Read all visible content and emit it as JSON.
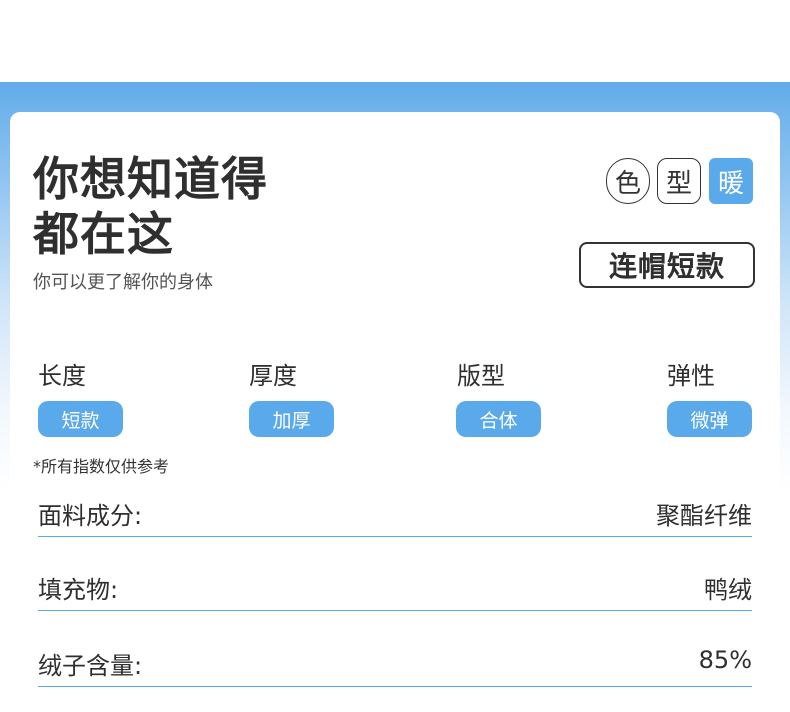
{
  "headline": {
    "line1": "你想知道得",
    "line2": "都在这",
    "subtitle": "你可以更了解你的身体"
  },
  "tags": [
    {
      "label": "色",
      "style": "circle",
      "active": false
    },
    {
      "label": "型",
      "style": "square",
      "active": false
    },
    {
      "label": "暖",
      "style": "square",
      "active": true
    }
  ],
  "model": "连帽短款",
  "attributes": [
    {
      "label": "长度",
      "value": "短款"
    },
    {
      "label": "厚度",
      "value": "加厚"
    },
    {
      "label": "版型",
      "value": "合体"
    },
    {
      "label": "弹性",
      "value": "微弹"
    }
  ],
  "note": "*所有指数仅供参考",
  "specs": [
    {
      "key": "面料成分:",
      "value": "聚酯纤维"
    },
    {
      "key": "填充物:",
      "value": "鸭绒"
    },
    {
      "key": "绒子含量:",
      "value": "85%"
    }
  ],
  "colors": {
    "accent": "#5aa9ea",
    "band_top": "#62acea",
    "text": "#2f2f2f"
  }
}
